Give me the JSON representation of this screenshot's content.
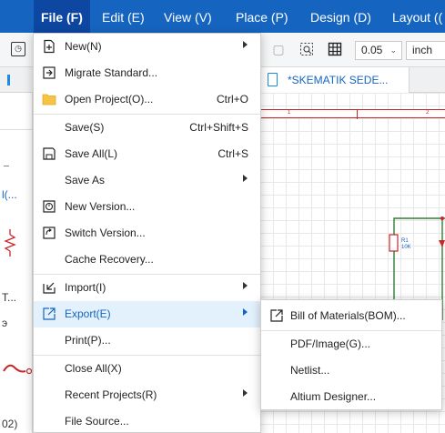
{
  "menubar": {
    "items": [
      {
        "label": "File (F)"
      },
      {
        "label": "Edit (E)"
      },
      {
        "label": "View (V)"
      },
      {
        "label": "Place (P)"
      },
      {
        "label": "Design (D)"
      },
      {
        "label": "Layout (("
      }
    ]
  },
  "toolbar": {
    "grid_value": "0.05",
    "unit_value": "inch"
  },
  "document_tab": {
    "label": "*SKEMATIK SEDE..."
  },
  "left_panel": {
    "texts": [
      "l(...",
      "T...",
      "э",
      "02)"
    ]
  },
  "canvas": {
    "ruler_marks": [
      "1",
      "2"
    ],
    "component_ref": "R1",
    "component_value": "10K"
  },
  "file_menu": {
    "items": [
      {
        "label": "New(N)",
        "icon": "new-file-icon",
        "has_submenu": true,
        "shortcut": ""
      },
      {
        "label": "Migrate Standard...",
        "icon": "migrate-icon",
        "has_submenu": false,
        "shortcut": ""
      },
      {
        "label": "Open Project(O)...",
        "icon": "folder-icon",
        "has_submenu": false,
        "shortcut": "Ctrl+O"
      },
      {
        "label": "Save(S)",
        "icon": "",
        "has_submenu": false,
        "shortcut": "Ctrl+Shift+S"
      },
      {
        "label": "Save All(L)",
        "icon": "save-all-icon",
        "has_submenu": false,
        "shortcut": "Ctrl+S"
      },
      {
        "label": "Save As",
        "icon": "",
        "has_submenu": true,
        "shortcut": ""
      },
      {
        "label": "New Version...",
        "icon": "new-version-icon",
        "has_submenu": false,
        "shortcut": ""
      },
      {
        "label": "Switch Version...",
        "icon": "switch-version-icon",
        "has_submenu": false,
        "shortcut": ""
      },
      {
        "label": "Cache Recovery...",
        "icon": "",
        "has_submenu": false,
        "shortcut": ""
      },
      {
        "label": "Import(I)",
        "icon": "import-icon",
        "has_submenu": true,
        "shortcut": ""
      },
      {
        "label": "Export(E)",
        "icon": "export-icon",
        "has_submenu": true,
        "shortcut": "",
        "highlighted": true
      },
      {
        "label": "Print(P)...",
        "icon": "",
        "has_submenu": false,
        "shortcut": ""
      },
      {
        "label": "Close All(X)",
        "icon": "",
        "has_submenu": false,
        "shortcut": ""
      },
      {
        "label": "Recent Projects(R)",
        "icon": "",
        "has_submenu": true,
        "shortcut": ""
      },
      {
        "label": "File Source...",
        "icon": "",
        "has_submenu": false,
        "shortcut": ""
      }
    ]
  },
  "export_submenu": {
    "items": [
      {
        "label": "Bill of Materials(BOM)...",
        "icon": "export-icon"
      },
      {
        "label": "PDF/Image(G)..."
      },
      {
        "label": "Netlist..."
      },
      {
        "label": "Altium Designer..."
      }
    ]
  },
  "colors": {
    "menubar_bg": "#1565c0",
    "highlight_bg": "#e3f1fd",
    "highlight_text": "#1565c0",
    "wire_red": "#c62828",
    "wire_green": "#2e7d32"
  }
}
